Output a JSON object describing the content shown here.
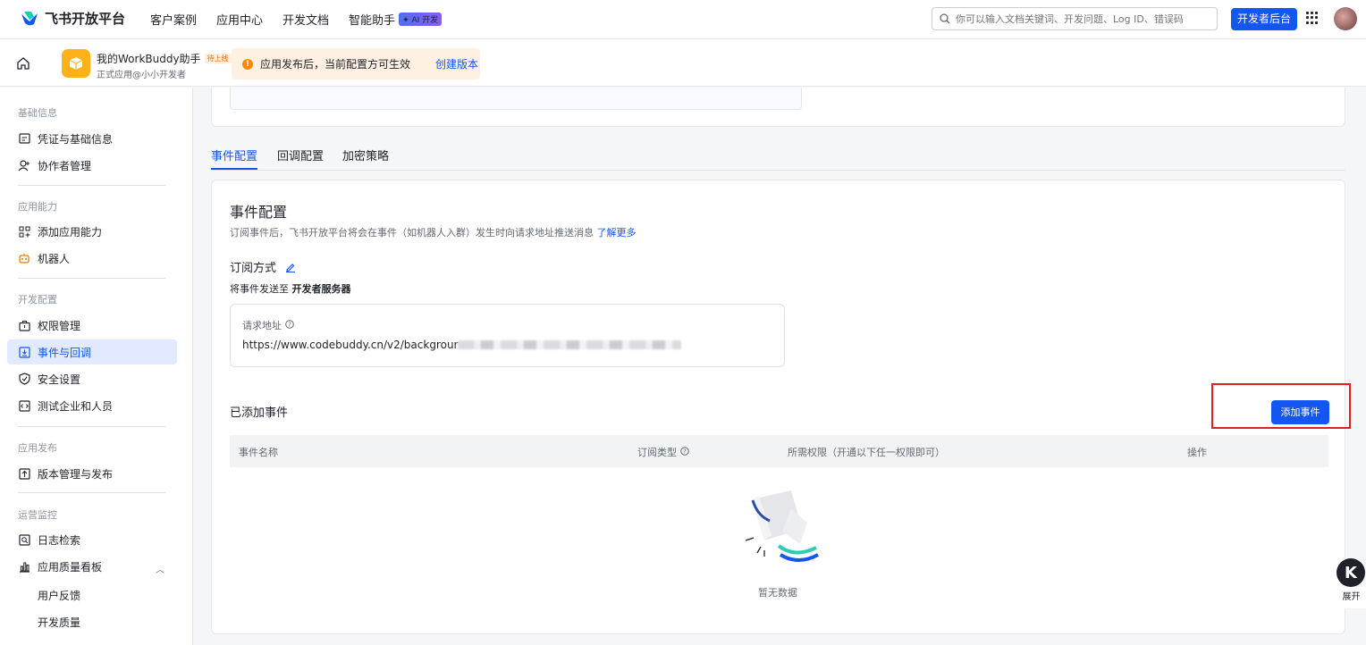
{
  "topbar": {
    "brand": "飞书开放平台",
    "nav": [
      "客户案例",
      "应用中心",
      "开发文档",
      "智能助手"
    ],
    "ai_badge": "✦ AI 开发",
    "search_placeholder": "你可以输入文档关键词、开发问题、Log ID、错误码",
    "dev_console": "开发者后台"
  },
  "subbar": {
    "app_name": "我的WorkBuddy助手",
    "pending_tag": "待上线",
    "app_sub": "正式应用@小小开发者",
    "notice_text": "应用发布后，当前配置方可生效",
    "notice_link": "创建版本"
  },
  "sidebar": {
    "sections": [
      {
        "title": "基础信息",
        "items": [
          "凭证与基础信息",
          "协作者管理"
        ]
      },
      {
        "title": "应用能力",
        "items": [
          "添加应用能力",
          "机器人"
        ]
      },
      {
        "title": "开发配置",
        "items": [
          "权限管理",
          "事件与回调",
          "安全设置",
          "测试企业和人员"
        ]
      },
      {
        "title": "应用发布",
        "items": [
          "版本管理与发布"
        ]
      },
      {
        "title": "运营监控",
        "items": [
          "日志检索",
          "应用质量看板"
        ]
      }
    ],
    "sub_items": [
      "用户反馈",
      "开发质量"
    ],
    "active": "事件与回调"
  },
  "tabs": [
    "事件配置",
    "回调配置",
    "加密策略"
  ],
  "event_config": {
    "title": "事件配置",
    "desc": "订阅事件后，飞书开放平台将会在事件（如机器人入群）发生时向请求地址推送消息",
    "learn_more": "了解更多",
    "sub_mode_label": "订阅方式",
    "send_to_prefix": "将事件发送至",
    "send_to_target": "开发者服务器",
    "request_url_label": "请求地址",
    "request_url": "https://www.codebuddy.cn/v2/backgrour",
    "added_title": "已添加事件",
    "add_button": "添加事件",
    "columns": [
      "事件名称",
      "订阅类型",
      "所需权限（开通以下任一权限即可）",
      "操作"
    ],
    "empty_text": "暂无数据"
  },
  "floating": {
    "letter": "K",
    "label": "展开"
  },
  "colors": {
    "primary": "#1456f0",
    "active_bg": "#e1eaff",
    "notice_bg": "#fef1e1",
    "highlight": "#e02020"
  }
}
